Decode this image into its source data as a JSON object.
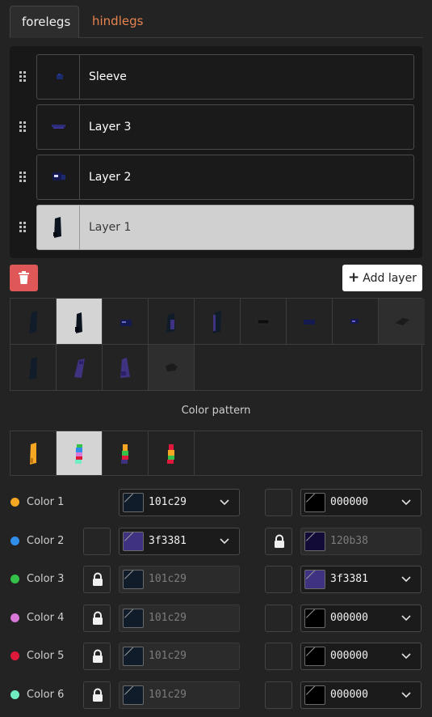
{
  "tabs": [
    {
      "label": "forelegs",
      "active": true
    },
    {
      "label": "hindlegs",
      "active": false
    }
  ],
  "layers": [
    {
      "name": "Sleeve",
      "selected": false,
      "thumb": "sleeve-thumb"
    },
    {
      "name": "Layer 3",
      "selected": false,
      "thumb": "layer3-thumb"
    },
    {
      "name": "Layer 2",
      "selected": false,
      "thumb": "layer2-thumb"
    },
    {
      "name": "Layer 1",
      "selected": true,
      "thumb": "layer1-thumb"
    }
  ],
  "actions": {
    "delete_icon": "trash-icon",
    "add_label": "Add layer",
    "add_icon": "plus-icon"
  },
  "section": {
    "color_pattern_title": "Color pattern"
  },
  "colors": {
    "accent_delete": "#e05757",
    "tab_inactive": "#e8844f"
  },
  "color_rows": [
    {
      "label": "Color 1",
      "dot": "#f5a623",
      "left": {
        "locked": false,
        "show_lock_box": false,
        "value": "101c29",
        "swatch": "#101c29",
        "disabled": false
      },
      "right": {
        "locked": false,
        "value": "000000",
        "swatch": "#000000",
        "disabled": false
      }
    },
    {
      "label": "Color 2",
      "dot": "#2f8fea",
      "left": {
        "locked": false,
        "show_lock_box": true,
        "value": "3f3381",
        "swatch": "#3f3381",
        "disabled": false
      },
      "right": {
        "locked": true,
        "value": "120b38",
        "swatch": "#120b38",
        "disabled": true
      }
    },
    {
      "label": "Color 3",
      "dot": "#33c14a",
      "left": {
        "locked": true,
        "show_lock_box": true,
        "value": "101c29",
        "swatch": "#101c29",
        "disabled": true
      },
      "right": {
        "locked": false,
        "value": "3f3381",
        "swatch": "#3f3381",
        "disabled": false
      }
    },
    {
      "label": "Color 4",
      "dot": "#d878d8",
      "left": {
        "locked": true,
        "show_lock_box": true,
        "value": "101c29",
        "swatch": "#101c29",
        "disabled": true
      },
      "right": {
        "locked": false,
        "value": "000000",
        "swatch": "#000000",
        "disabled": false
      }
    },
    {
      "label": "Color 5",
      "dot": "#e0183c",
      "left": {
        "locked": true,
        "show_lock_box": true,
        "value": "101c29",
        "swatch": "#101c29",
        "disabled": true
      },
      "right": {
        "locked": false,
        "value": "000000",
        "swatch": "#000000",
        "disabled": false
      }
    },
    {
      "label": "Color 6",
      "dot": "#6fedc0",
      "left": {
        "locked": true,
        "show_lock_box": true,
        "value": "101c29",
        "swatch": "#101c29",
        "disabled": true
      },
      "right": {
        "locked": false,
        "value": "000000",
        "swatch": "#000000",
        "disabled": false
      }
    }
  ]
}
